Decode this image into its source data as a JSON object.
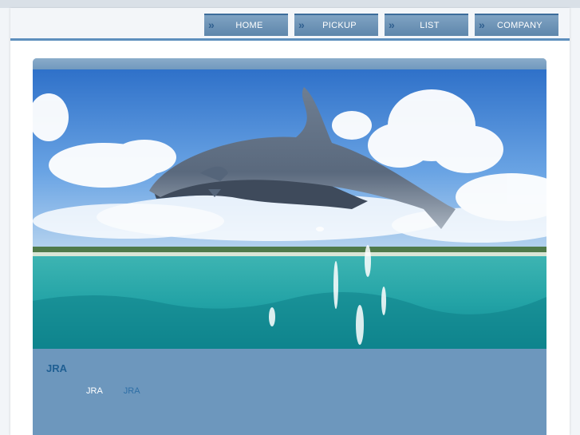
{
  "nav": {
    "items": [
      {
        "label": "HOME",
        "icon": "double-chevron-right-icon"
      },
      {
        "label": "PICKUP",
        "icon": "double-chevron-right-icon"
      },
      {
        "label": "LIST",
        "icon": "double-chevron-right-icon"
      },
      {
        "label": "COMPANY",
        "icon": "double-chevron-right-icon"
      }
    ]
  },
  "hero": {
    "image": "dolphins-jumping-over-ocean"
  },
  "site": {
    "title": "JRA",
    "links": [
      {
        "label": "JRA"
      },
      {
        "label": "JRA"
      }
    ]
  },
  "colors": {
    "accent": "#5d8fbd",
    "content_bg": "#6d97bd",
    "title": "#1f5f93",
    "link_blue": "#2e6fa6"
  }
}
